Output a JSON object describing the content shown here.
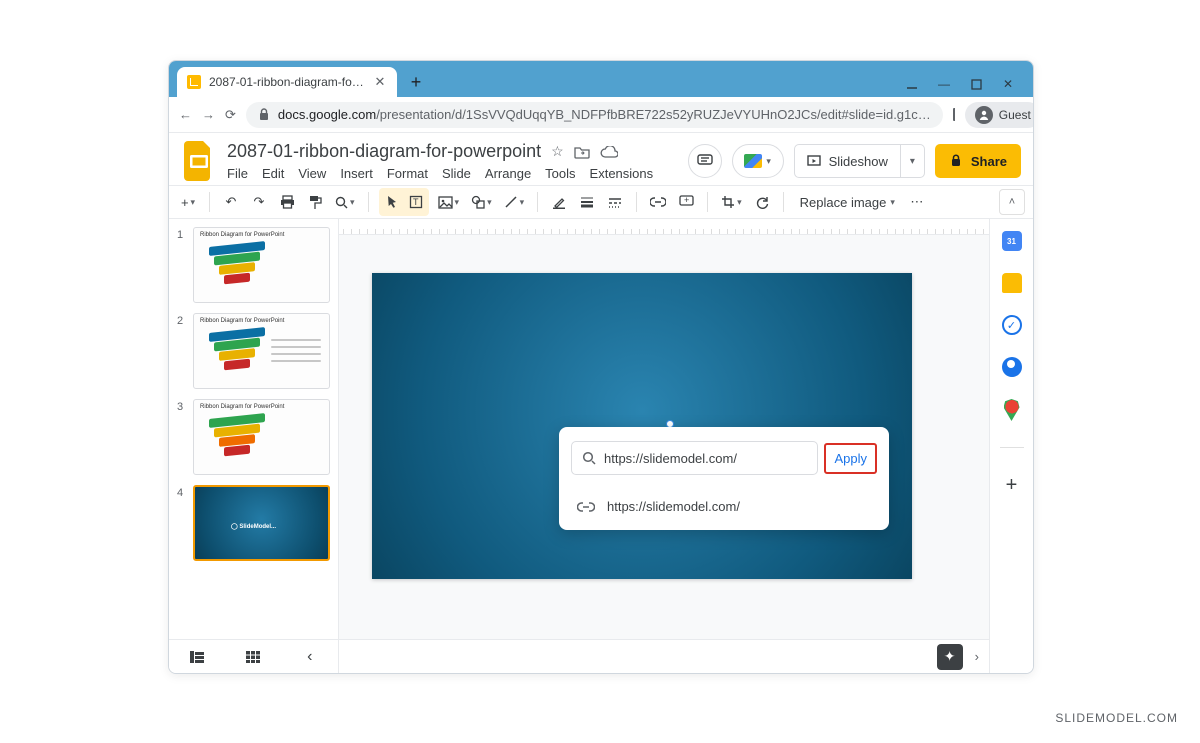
{
  "watermark": "SLIDEMODEL.COM",
  "browser": {
    "tab_title": "2087-01-ribbon-diagram-for-po",
    "url_prefix": "docs.google.com",
    "url_rest": "/presentation/d/1SsVVQdUqqYB_NDFPfbBRE722s52yRUZJeVYUHnO2JCs/edit#slide=id.g1c…",
    "guest_label": "Guest"
  },
  "doc": {
    "title": "2087-01-ribbon-diagram-for-powerpoint",
    "menus": [
      "File",
      "Edit",
      "View",
      "Insert",
      "Format",
      "Slide",
      "Arrange",
      "Tools",
      "Extensions"
    ],
    "slideshow_label": "Slideshow",
    "share_label": "Share"
  },
  "toolbar": {
    "replace_label": "Replace image"
  },
  "filmstrip": {
    "slides": [
      {
        "num": "1",
        "title": "Ribbon Diagram for PowerPoint"
      },
      {
        "num": "2",
        "title": "Ribbon Diagram for PowerPoint"
      },
      {
        "num": "3",
        "title": "Ribbon Diagram for PowerPoint"
      },
      {
        "num": "4",
        "title": ""
      }
    ]
  },
  "canvas": {
    "logo_text": "SlideModel",
    "logo_suffix": ".com"
  },
  "link_popup": {
    "input_value": "https://slidemodel.com/",
    "apply_label": "Apply",
    "suggestion": "https://slidemodel.com/"
  }
}
